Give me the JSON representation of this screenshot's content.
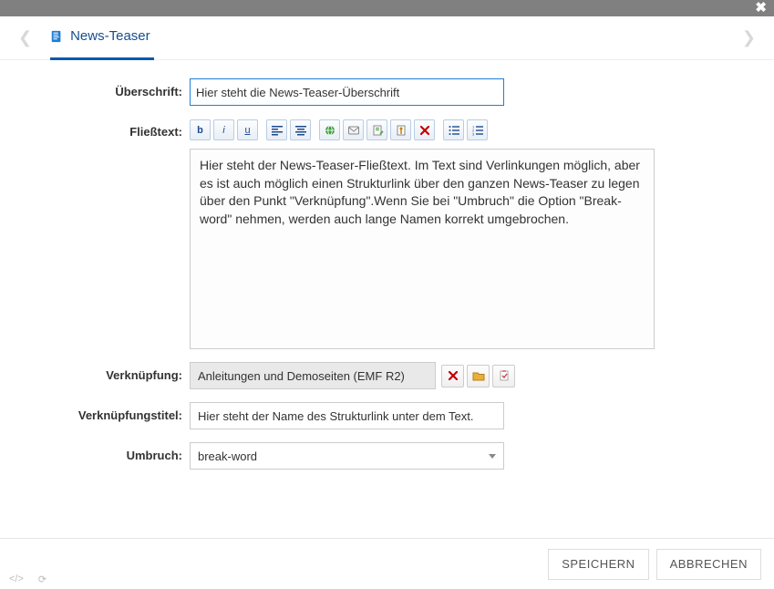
{
  "titlebar": {
    "close_symbol": "✖"
  },
  "tabs": {
    "title": "News-Teaser"
  },
  "form": {
    "heading_label": "Überschrift:",
    "heading_value": "Hier steht die News-Teaser-Überschrift",
    "body_label": "Fließtext:",
    "body_value": "Hier steht der News-Teaser-Fließtext. Im Text sind Verlinkungen möglich, aber es ist auch möglich einen Strukturlink über den ganzen News-Teaser zu legen über den Punkt \"Verknüpfung\".Wenn Sie bei \"Umbruch\" die Option \"Break-word\" nehmen, werden auch lange Namen korrekt umgebrochen.",
    "link_label": "Verknüpfung:",
    "link_value": "Anleitungen und Demoseiten (EMF R2)",
    "linktitle_label": "Verknüpfungstitel:",
    "linktitle_value": "Hier steht der Name des Strukturlink unter dem Text.",
    "wrap_label": "Umbruch:",
    "wrap_value": "break-word"
  },
  "toolbar_icons": {
    "bold_label": "b",
    "italic_label": "i",
    "underline_label": "u"
  },
  "footer": {
    "save_label": "SPEICHERN",
    "cancel_label": "ABBRECHEN"
  }
}
